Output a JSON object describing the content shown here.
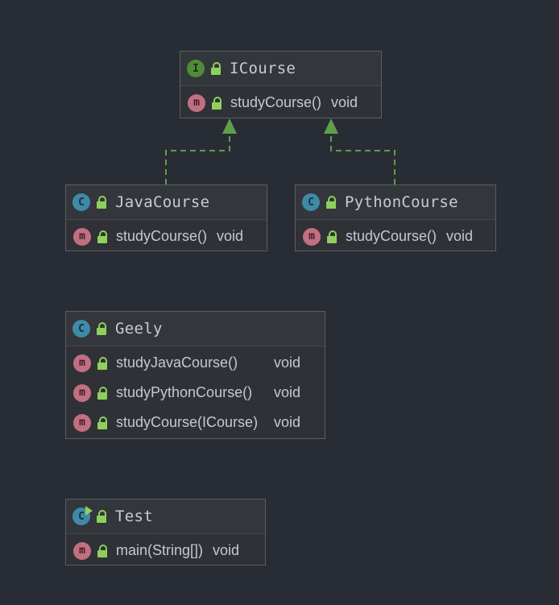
{
  "colors": {
    "background": "#282c34",
    "interface_badge": "#4e8b3a",
    "class_badge": "#3f8aa8",
    "method_badge": "#c26f82",
    "lock": "#8fd05a",
    "relation_line": "#5f9e4a"
  },
  "badges": {
    "interface": "I",
    "class": "C",
    "method": "m"
  },
  "nodes": {
    "icourse": {
      "title": "ICourse",
      "members": [
        {
          "name": "studyCourse()",
          "type": "void"
        }
      ]
    },
    "javacourse": {
      "title": "JavaCourse",
      "members": [
        {
          "name": "studyCourse()",
          "type": "void"
        }
      ]
    },
    "pythoncourse": {
      "title": "PythonCourse",
      "members": [
        {
          "name": "studyCourse()",
          "type": "void"
        }
      ]
    },
    "geely": {
      "title": "Geely",
      "members": [
        {
          "name": "studyJavaCourse()",
          "type": "void"
        },
        {
          "name": "studyPythonCourse()",
          "type": "void"
        },
        {
          "name": "studyCourse(ICourse)",
          "type": "void"
        }
      ]
    },
    "test": {
      "title": "Test",
      "members": [
        {
          "name": "main(String[])",
          "type": "void"
        }
      ]
    }
  },
  "relations": [
    {
      "from": "JavaCourse",
      "to": "ICourse",
      "kind": "implements"
    },
    {
      "from": "PythonCourse",
      "to": "ICourse",
      "kind": "implements"
    }
  ]
}
